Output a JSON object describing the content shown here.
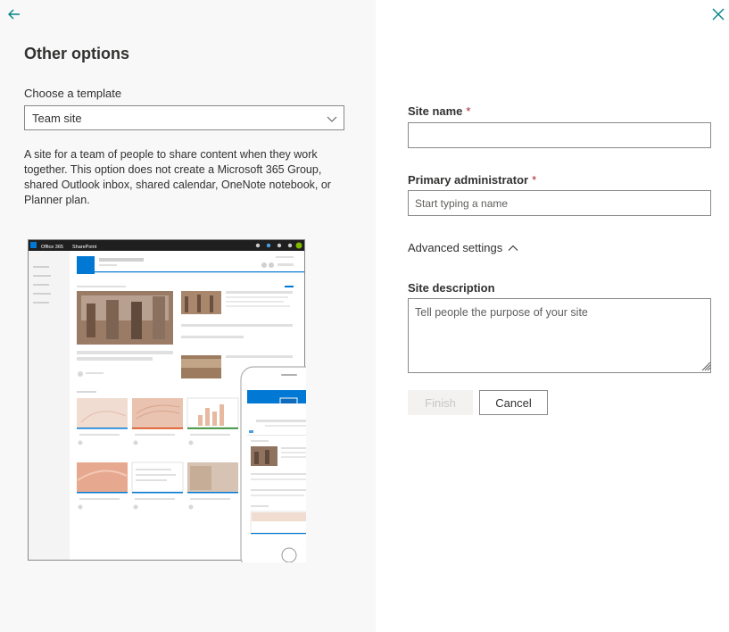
{
  "nav": {
    "back_icon": "arrow-left-icon",
    "close_icon": "close-icon",
    "accent": "#038387"
  },
  "left": {
    "heading": "Other options",
    "template_label": "Choose a template",
    "template_value": "Team site",
    "template_description": "A site for a team of people to share content when they work together. This option does not create a Microsoft 365 Group, shared Outlook inbox, shared calendar, OneNote notebook, or Planner plan.",
    "preview": {
      "suite_brand": "Office 365",
      "app_name": "SharePoint"
    }
  },
  "form": {
    "site_name_label": "Site name",
    "site_name_value": "",
    "admin_label": "Primary administrator",
    "admin_placeholder": "Start typing a name",
    "required_mark": "*",
    "advanced_label": "Advanced settings",
    "description_label": "Site description",
    "description_placeholder": "Tell people the purpose of your site",
    "finish_label": "Finish",
    "cancel_label": "Cancel"
  }
}
